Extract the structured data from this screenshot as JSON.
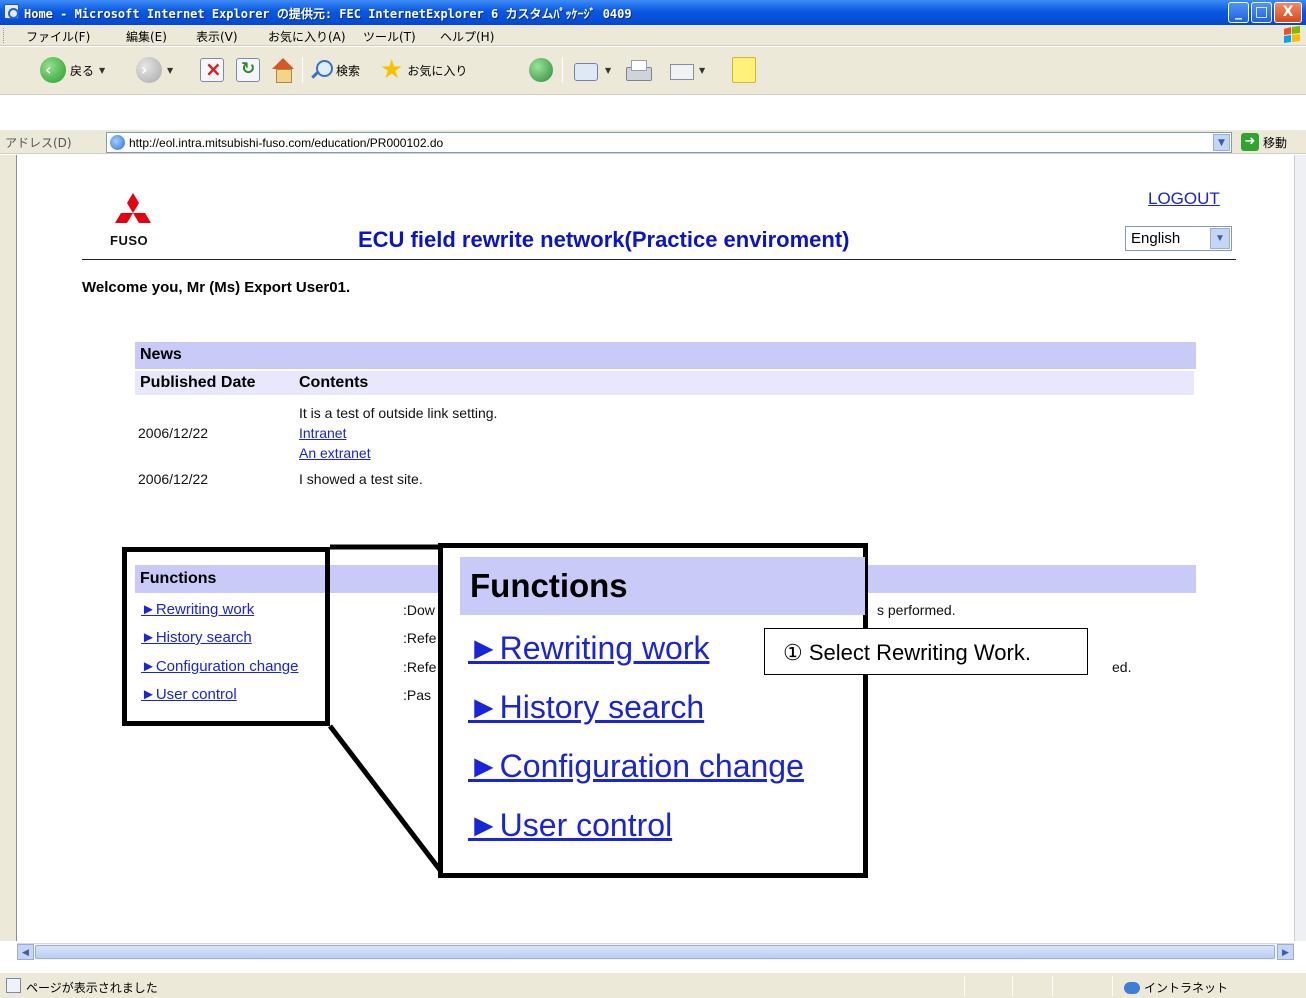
{
  "window": {
    "title": "Home - Microsoft Internet Explorer の提供元: FEC InternetExplorer 6 カスタムﾊﾟｯｹｰｼﾞ 0409",
    "min_glyph": "_",
    "max_glyph": "□",
    "close_glyph": "X"
  },
  "menu": {
    "items": [
      "ファイル(F)",
      "編集(E)",
      "表示(V)",
      "お気に入り(A)",
      "ツール(T)",
      "ヘルプ(H)"
    ]
  },
  "toolbar": {
    "back_label": "戻る",
    "search_label": "検索",
    "favorites_label": "お気に入り"
  },
  "address": {
    "label": "アドレス(D)",
    "url": "http://eol.intra.mitsubishi-fuso.com/education/PR000102.do",
    "go_label": "移動"
  },
  "page": {
    "logo_text": "FUSO",
    "title": "ECU field rewrite network(Practice enviroment)",
    "logout": "LOGOUT",
    "language": "English",
    "welcome": "Welcome you, Mr (Ms) Export User01."
  },
  "news": {
    "heading": "News",
    "col_date": "Published Date",
    "col_contents": "Contents",
    "rows": [
      {
        "date": "2006/12/22",
        "text": "It is a test of outside link setting.",
        "link1": "Intranet",
        "link2": "An extranet"
      },
      {
        "date": "2006/12/22",
        "text": "I showed a test site."
      }
    ]
  },
  "functions": {
    "heading": "Functions",
    "items": [
      {
        "label": "►Rewriting work",
        "desc": ":Dow",
        "tail": "s performed."
      },
      {
        "label": "►History search",
        "desc": ":Refe",
        "tail": ""
      },
      {
        "label": "►Configuration change",
        "desc": ":Refe",
        "tail": "ed."
      },
      {
        "label": "►User control",
        "desc": ":Pas",
        "tail": ""
      }
    ]
  },
  "zoom": {
    "heading": "Functions",
    "items": [
      "►Rewriting work",
      "►History search",
      "►Configuration change",
      "►User control"
    ]
  },
  "callout": {
    "text": "① Select Rewriting Work."
  },
  "status": {
    "text": "ページが表示されました",
    "zone": "イントラネット"
  },
  "colors": {
    "section_header_bg": "#cacaf9",
    "link": "#1a24d8",
    "title_blue": "#0a14c8",
    "logo_red": "#e60012"
  }
}
